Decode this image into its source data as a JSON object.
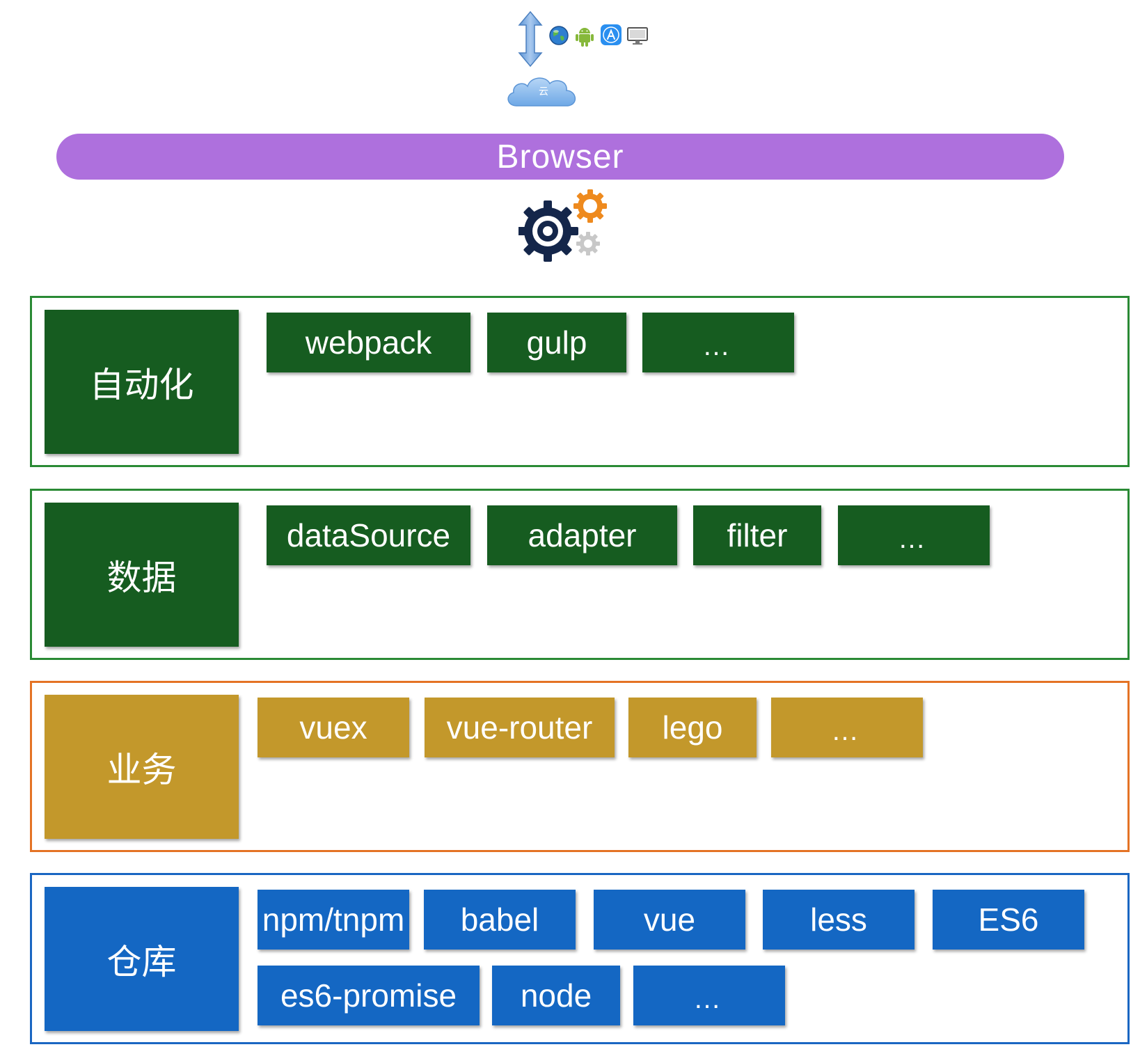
{
  "top": {
    "cloud_label": "云"
  },
  "browser": {
    "label": "Browser"
  },
  "layers": [
    {
      "label": "自动化",
      "items": [
        "webpack",
        "gulp",
        "…"
      ]
    },
    {
      "label": "数据",
      "items": [
        "dataSource",
        "adapter",
        "filter",
        "…"
      ]
    },
    {
      "label": "业务",
      "items": [
        "vuex",
        "vue-router",
        "lego",
        "…"
      ]
    },
    {
      "label": "仓库",
      "items": [
        "npm/tnpm",
        "babel",
        "vue",
        "less",
        "ES6",
        "es6-promise",
        "node",
        "…"
      ]
    }
  ],
  "colors": {
    "browser_bar": "#ae70dd",
    "automation_and_data_block": "#165c20",
    "automation_and_data_border": "#2a8a35",
    "business_block": "#c3982b",
    "business_border": "#e47325",
    "repo_block": "#1467c3",
    "repo_border": "#1a66c2",
    "gear_dark": "#14264a",
    "gear_orange": "#ee8a1e",
    "gear_gray": "#c8c8c8"
  },
  "icons": [
    "double-arrow-icon",
    "globe-icon",
    "android-icon",
    "appstore-icon",
    "desktop-icon",
    "cloud-icon",
    "gears-icon"
  ]
}
